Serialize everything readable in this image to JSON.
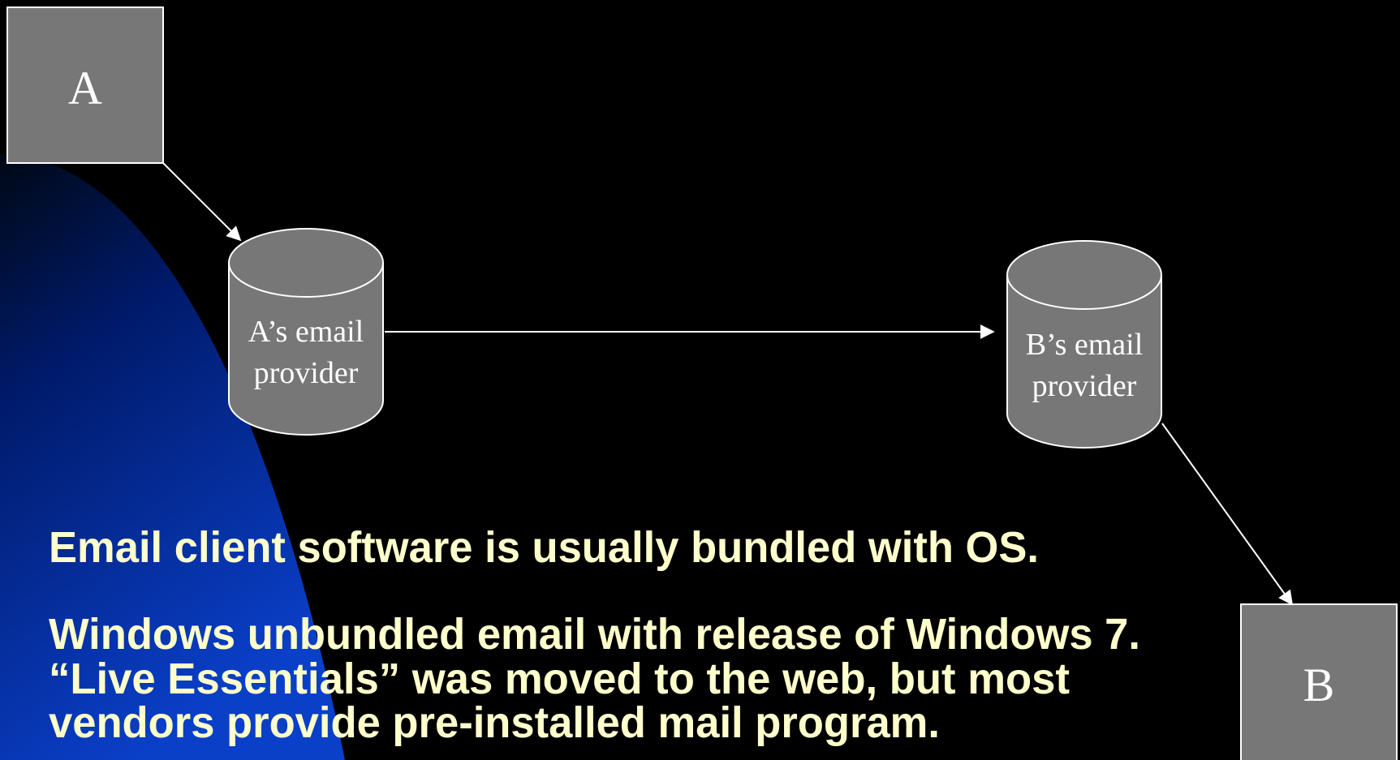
{
  "colors": {
    "background": "#000000",
    "accent_blue": "#0a32b8",
    "node_fill": "#777777",
    "node_stroke": "#ffffff",
    "node_text": "#ffffff",
    "arrow": "#ffffff",
    "caption_text": "#ffffcc"
  },
  "diagram": {
    "nodes": {
      "a": {
        "label": "A"
      },
      "a_provider": {
        "line1": "A’s email",
        "line2": "provider"
      },
      "b_provider": {
        "line1": "B’s email",
        "line2": "provider"
      },
      "b": {
        "label": "B"
      }
    }
  },
  "captions": {
    "line1": "Email client software is usually bundled with OS.",
    "line2": "Windows unbundled email with release of Windows 7.",
    "line3": "“Live Essentials” was moved to the web, but most",
    "line4": "vendors provide pre-installed mail program."
  }
}
